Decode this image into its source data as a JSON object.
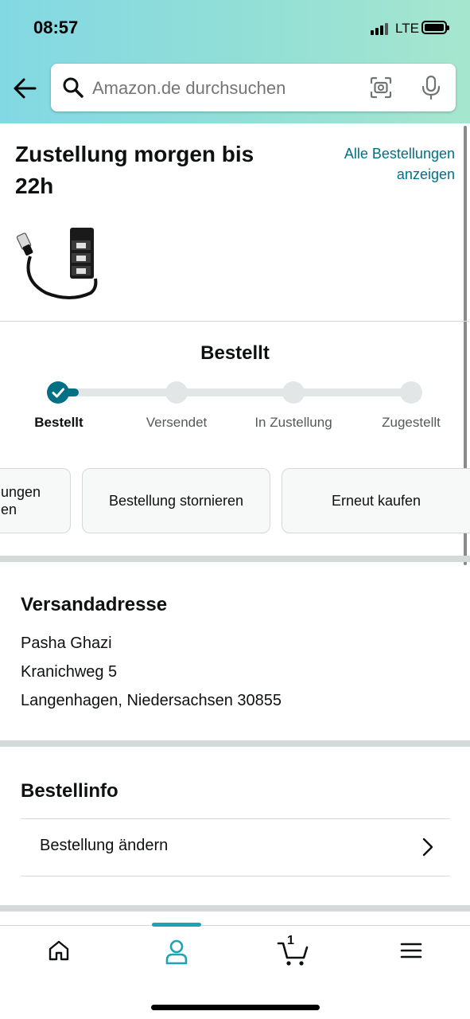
{
  "status_bar": {
    "time": "08:57",
    "network": "LTE"
  },
  "search": {
    "placeholder": "Amazon.de durchsuchen"
  },
  "order": {
    "delivery_title": "Zustellung morgen bis 22h",
    "all_orders_link": "Alle Bestellungen anzeigen",
    "product_icon": "ethernet-splitter-image"
  },
  "tracking": {
    "current_status": "Bestellt",
    "steps": [
      {
        "label": "Bestellt",
        "state": "done"
      },
      {
        "label": "Versendet",
        "state": "pending"
      },
      {
        "label": "In Zustellung",
        "state": "pending"
      },
      {
        "label": "Zugestellt",
        "state": "pending"
      }
    ]
  },
  "actions": {
    "first_partial": "ungen\nen",
    "cancel": "Bestellung stornieren",
    "buy_again": "Erneut kaufen"
  },
  "shipping": {
    "title": "Versandadresse",
    "name": "Pasha Ghazi",
    "street": "Kranichweg 5",
    "city": "Langenhagen, Niedersachsen 30855"
  },
  "order_info": {
    "title": "Bestellinfo",
    "change_order": "Bestellung ändern"
  },
  "bottom_nav": {
    "cart_count": "1",
    "items": [
      "home-icon",
      "account-icon",
      "cart-icon",
      "menu-icon"
    ],
    "active": "account-icon"
  },
  "colors": {
    "accent": "#007185",
    "nav_active": "#1EA3B6",
    "header_gradient": [
      "#82D8E3",
      "#A6E6CE"
    ]
  }
}
